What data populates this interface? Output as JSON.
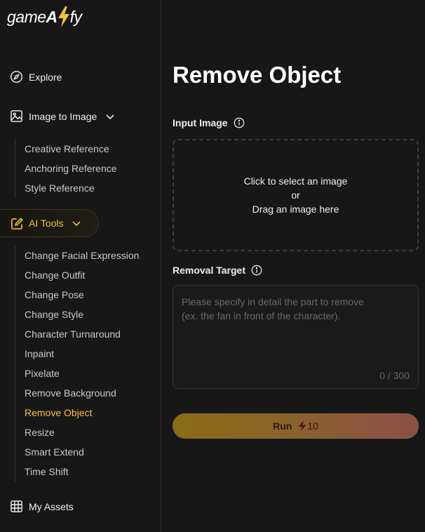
{
  "logo": {
    "text_before": "game",
    "text_after": "fy",
    "letter": "A"
  },
  "nav": {
    "explore": "Explore",
    "image_to_image": "Image to Image",
    "image_to_image_items": [
      "Creative Reference",
      "Anchoring Reference",
      "Style Reference"
    ],
    "ai_tools": "AI Tools",
    "ai_tools_items": [
      "Change Facial Expression",
      "Change Outfit",
      "Change Pose",
      "Change Style",
      "Character Turnaround",
      "Inpaint",
      "Pixelate",
      "Remove Background",
      "Remove Object",
      "Resize",
      "Smart Extend",
      "Time Shift"
    ],
    "active_item": "Remove Object",
    "my_assets": "My Assets"
  },
  "main": {
    "title": "Remove Object",
    "input_image_label": "Input Image",
    "dropzone": {
      "line1": "Click to select an image",
      "line2": "or",
      "line3": "Drag an image here"
    },
    "removal_target_label": "Removal Target",
    "removal_target_placeholder": "Please specify in detail the part to remove\n(ex. the fan in front of the character).",
    "removal_target_value": "",
    "counter": "0 / 300",
    "run_label": "Run",
    "run_cost": "10"
  },
  "colors": {
    "accent": "#f5c13b",
    "background": "#171717"
  }
}
